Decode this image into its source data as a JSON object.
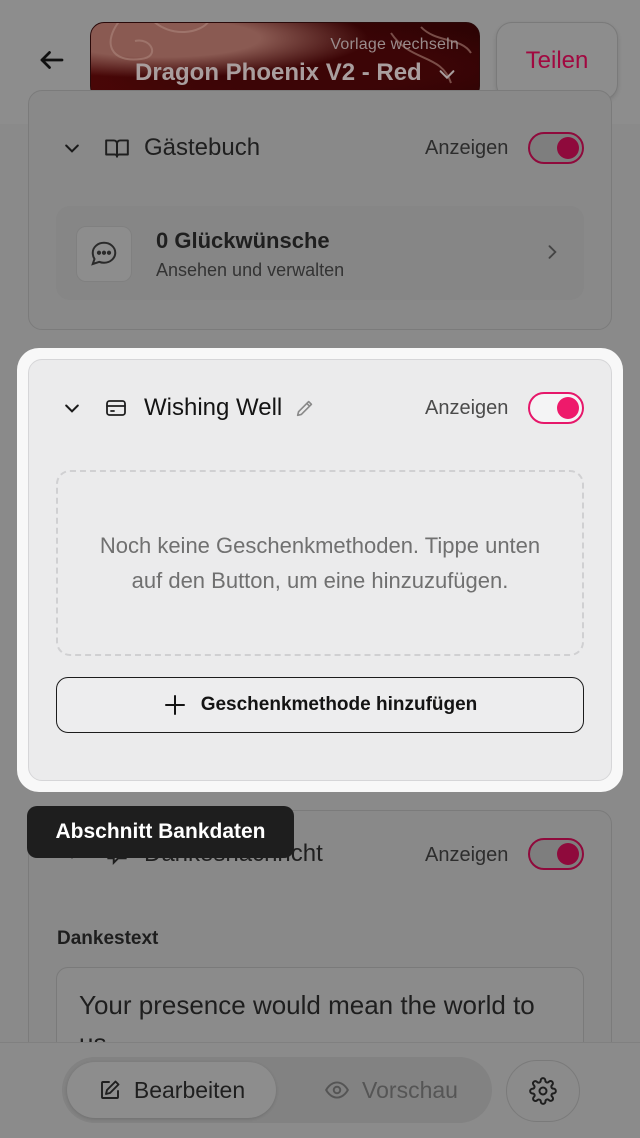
{
  "header": {
    "template_caption": "Vorlage wechseln",
    "template_name": "Dragon Phoenix V2 - Red",
    "share_label": "Teilen"
  },
  "guestbook": {
    "title": "Gästebuch",
    "show_label": "Anzeigen",
    "enabled": true,
    "entry_title": "0 Glückwünsche",
    "entry_subtitle": "Ansehen und verwalten"
  },
  "wishing_well": {
    "title": "Wishing Well",
    "show_label": "Anzeigen",
    "enabled": true,
    "empty_text": "Noch keine Geschenkmethoden. Tippe unten auf den Button, um eine hinzuzufügen.",
    "add_button_label": "Geschenkmethode hinzufügen"
  },
  "tooltip": {
    "text": "Abschnitt Bankdaten"
  },
  "thanks": {
    "title": "Dankesnachricht",
    "show_label": "Anzeigen",
    "enabled": true,
    "field_label": "Dankestext",
    "field_value": "Your presence would mean the world to us"
  },
  "bottom_bar": {
    "edit_label": "Bearbeiten",
    "preview_label": "Vorschau"
  },
  "colors": {
    "accent": "#ee1a6b",
    "overlay": "#8a8a8a",
    "tooltip_bg": "#1e1e1e"
  }
}
